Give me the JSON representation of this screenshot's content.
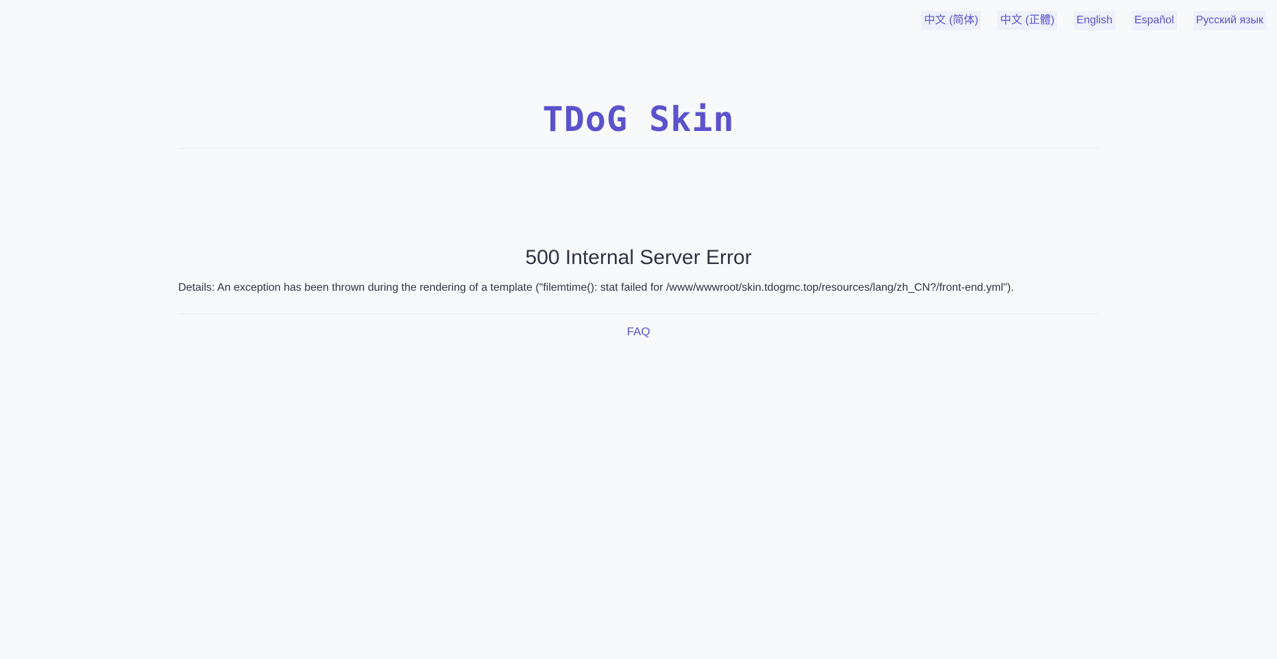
{
  "languages": [
    {
      "label": "中文 (简体)"
    },
    {
      "label": "中文 (正體)"
    },
    {
      "label": "English"
    },
    {
      "label": "Español"
    },
    {
      "label": "Русский язык"
    }
  ],
  "header": {
    "site_title": "TDoG Skin"
  },
  "error": {
    "title": "500 Internal Server Error",
    "details": "Details: An exception has been thrown during the rendering of a template (\"filemtime(): stat failed for /www/wwwroot/skin.tdogmc.top/resources/lang/zh_CN?/front-end.yml\")."
  },
  "footer": {
    "faq_label": "FAQ"
  },
  "colors": {
    "accent": "#5b52cc",
    "background": "#f8f9fb",
    "text": "#2f3440"
  }
}
